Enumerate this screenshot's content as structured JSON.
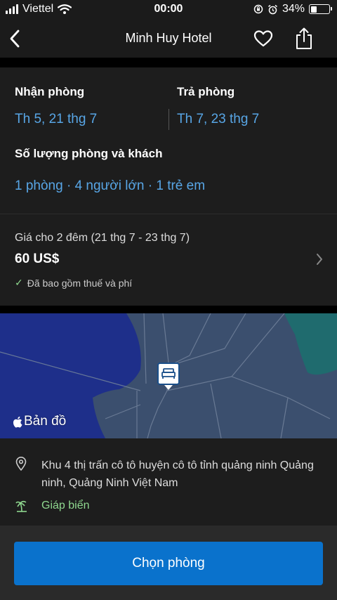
{
  "status_bar": {
    "carrier": "Viettel",
    "time": "00:00",
    "battery_percent": "34%",
    "battery_level": 0.34
  },
  "nav": {
    "title": "Minh Huy Hotel",
    "back_icon": "chevron-left-icon",
    "favorite_icon": "heart-icon",
    "share_icon": "share-icon"
  },
  "dates": {
    "checkin_label": "Nhận phòng",
    "checkin_value": "Th 5, 21 thg 7",
    "checkout_label": "Trả phòng",
    "checkout_value": "Th 7, 23 thg 7",
    "guests_label": "Số lượng phòng và khách",
    "guests_value": "1 phòng · 4 người lớn · 1 trẻ em"
  },
  "price": {
    "caption": "Giá cho 2 đêm (21 thg 7 - 23 thg 7)",
    "value": "60 US$",
    "note_check": "✓",
    "note": "Đã bao gồm thuế và phí"
  },
  "map": {
    "label": "Bản đồ",
    "marker_icon": "bed-icon"
  },
  "address": {
    "text": "Khu 4 thị trấn cô tô huyện cô tô tỉnh quảng ninh Quảng ninh, Quảng Ninh Việt Nam",
    "beach": "Giáp biển"
  },
  "cta": {
    "label": "Chọn phòng"
  },
  "colors": {
    "accent_blue": "#58a6e6",
    "button_blue": "#0a72cc",
    "beach_green": "#8fd88f",
    "water": "#1e2f8a",
    "land": "#3b4f6e"
  }
}
